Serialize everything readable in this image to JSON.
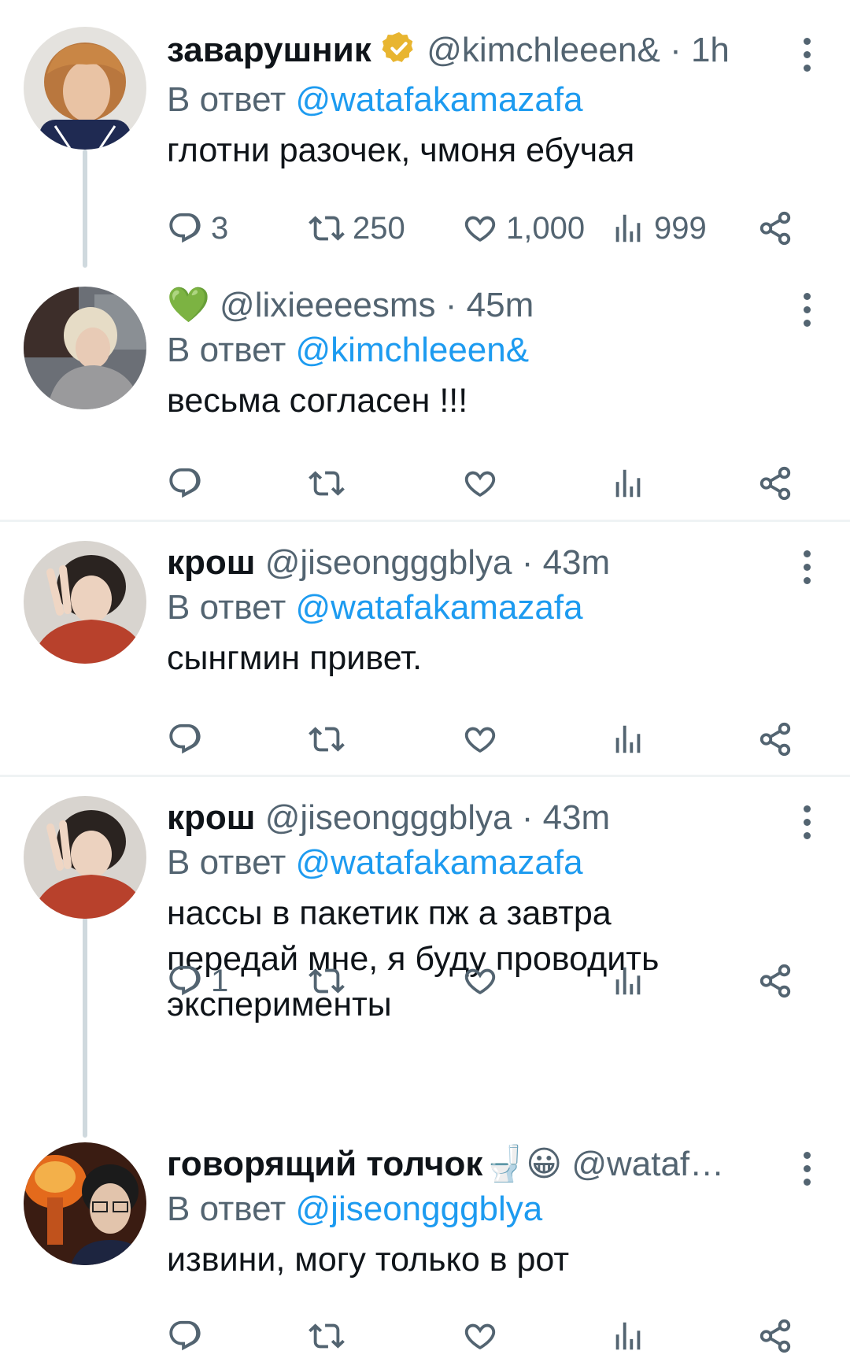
{
  "tweets": [
    {
      "display_name": "заварушник",
      "verified": true,
      "handle": "@kimchleeen&",
      "time": "· 1h",
      "reply_prefix": "В ответ",
      "reply_to": "@watafakamazafa",
      "text": "глотни разочек, чмоня ебучая",
      "replies": "3",
      "retweets": "250",
      "likes": "1,000",
      "views": "999"
    },
    {
      "display_name": "💚",
      "handle": "@lixieeeesms",
      "time": "· 45m",
      "reply_prefix": "В ответ",
      "reply_to": "@kimchleeen&",
      "text": "весьма согласен !!!"
    },
    {
      "display_name": "крош",
      "handle": "@jiseongggblya",
      "time": "· 43m",
      "reply_prefix": "В ответ",
      "reply_to": "@watafakamazafa",
      "text": "сынгмин привет."
    },
    {
      "display_name": "крош",
      "handle": "@jiseongggblya",
      "time": "· 43m",
      "reply_prefix": "В ответ",
      "reply_to": "@watafakamazafa",
      "text_lines": [
        "нассы в пакетик пж а завтра",
        "передай мне, я буду проводить",
        "эксперименты"
      ],
      "replies": "1"
    },
    {
      "display_name": "говорящий толчок",
      "name_emojis": "🚽😀",
      "handle": "@wataf…",
      "reply_prefix": "В ответ",
      "reply_to": "@jiseongggblya",
      "text": "извини, могу только в рот"
    }
  ],
  "colors": {
    "link": "#1d9bf0",
    "muted": "#536471",
    "verified": "#e8b530",
    "text": "#0f1419"
  },
  "icons": [
    "reply-icon",
    "retweet-icon",
    "like-icon",
    "views-icon",
    "share-icon",
    "more-icon",
    "verified-badge-icon"
  ]
}
